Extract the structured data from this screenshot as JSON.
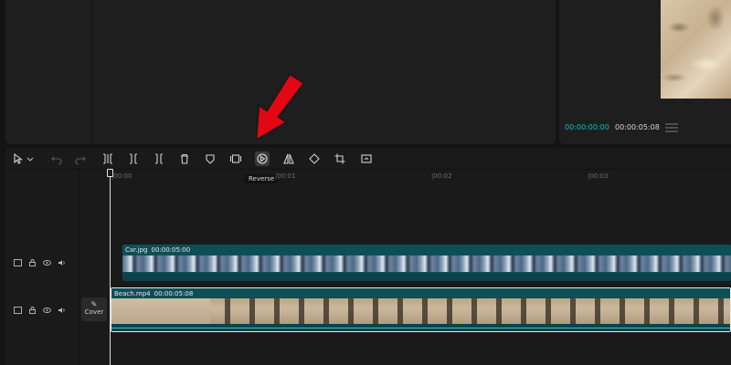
{
  "preview": {
    "current_time": "00:00:00:00",
    "total_time": "00:00:05:08"
  },
  "toolbar": {
    "tools": [
      {
        "name": "select-tool",
        "icon": "cursor-icon"
      },
      {
        "name": "undo-button",
        "icon": "undo-icon"
      },
      {
        "name": "redo-button",
        "icon": "redo-icon"
      },
      {
        "name": "split-button",
        "icon": "split-icon"
      },
      {
        "name": "delete-left-button",
        "icon": "trim-left-icon"
      },
      {
        "name": "delete-right-button",
        "icon": "trim-right-icon"
      },
      {
        "name": "delete-button",
        "icon": "trash-icon"
      },
      {
        "name": "marker-button",
        "icon": "marker-icon"
      },
      {
        "name": "freeze-button",
        "icon": "freeze-icon"
      },
      {
        "name": "reverse-button",
        "icon": "reverse-icon"
      },
      {
        "name": "mirror-button",
        "icon": "mirror-icon"
      },
      {
        "name": "rotate-button",
        "icon": "rotate-icon"
      },
      {
        "name": "crop-button",
        "icon": "crop-icon"
      },
      {
        "name": "crop-ratio-button",
        "icon": "crop-ratio-icon"
      }
    ],
    "tooltip": "Reverse"
  },
  "ruler": {
    "labels": [
      "|00:00",
      "|00:01",
      "|00:02",
      "|00:03"
    ]
  },
  "tracks": {
    "cover_label": "Cover",
    "clip_car": {
      "name": "Car.jpg",
      "duration": "00:00:05:00"
    },
    "clip_beach": {
      "name": "Beach.mp4",
      "duration": "00:00:05:08"
    }
  },
  "colors": {
    "accent": "#21b3c2",
    "clip": "#0e4f56",
    "annotation_arrow": "#e30613"
  }
}
